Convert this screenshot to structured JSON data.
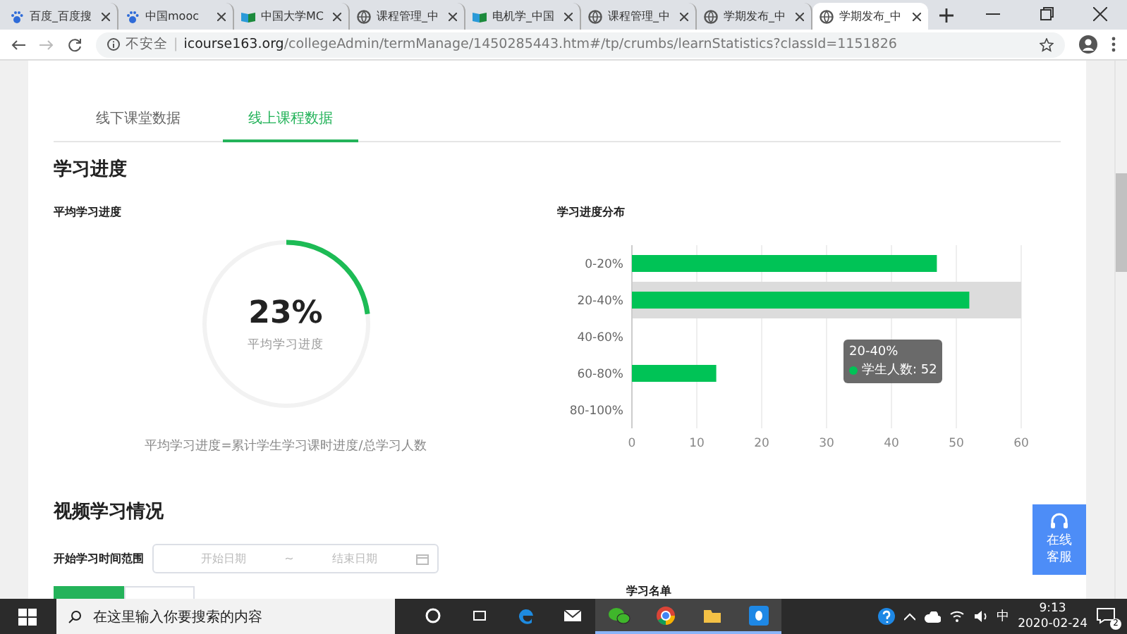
{
  "browser": {
    "tabs": [
      {
        "kind": "paw",
        "title": "百度_百度搜",
        "selected": false
      },
      {
        "kind": "paw",
        "title": "中国mooc",
        "selected": false
      },
      {
        "kind": "book",
        "title": "中国大学MC",
        "selected": false
      },
      {
        "kind": "globe",
        "title": "课程管理_中",
        "selected": false
      },
      {
        "kind": "book",
        "title": "电机学_中国",
        "selected": false
      },
      {
        "kind": "globe",
        "title": "课程管理_中",
        "selected": false
      },
      {
        "kind": "globe",
        "title": "学期发布_中",
        "selected": false
      },
      {
        "kind": "globe",
        "title": "学期发布_中",
        "selected": true
      }
    ],
    "security": "不安全",
    "security_divider": "|",
    "url": "**icourse163.org**/collegeAdmin/termManage/1450285443.htm#/tp/crumbs/learnStatistics?classId=1151826"
  },
  "page": {
    "tabs": [
      {
        "label": "线下课堂数据",
        "selected": false
      },
      {
        "label": "线上课程数据",
        "selected": true
      }
    ],
    "progress_section": {
      "title": "学习进度",
      "average": {
        "title": "平均学习进度",
        "value": "23%",
        "caption": "平均学习进度",
        "level": 0.23,
        "formula": "平均学习进度=累计学生学习课时进度/总学习人数"
      },
      "distribution": {
        "title": "学习进度分布",
        "tooltip": {
          "title": "20-40%",
          "text": "学生人数: 52",
          "color": "#00c356"
        },
        "chart_data": {
          "type": "bar",
          "orientation": "horizontal",
          "categories": [
            "0-20%",
            "20-40%",
            "40-60%",
            "60-80%",
            "80-100%"
          ],
          "series": [
            {
              "color": "#00c356",
              "values": [
                47,
                52,
                0,
                13,
                0
              ]
            }
          ],
          "xlim": [
            0,
            60
          ],
          "xticks": [
            0,
            10,
            20,
            30,
            40,
            50,
            60
          ],
          "grid": true,
          "bands": [
            {
              "axis": "y",
              "from": "20-40%",
              "to": "20-40%",
              "color": "#dcdcdc"
            }
          ]
        }
      }
    },
    "video_section": {
      "title": "视频学习情况",
      "range_label": "开始学习时间范围",
      "start_placeholder": "开始日期",
      "separator": "~",
      "end_placeholder": "结束日期",
      "toggle": [
        {
          "selected": true
        },
        {
          "selected": false
        }
      ],
      "list_title": "学习名单"
    },
    "service": {
      "label": "在线客服"
    }
  },
  "taskbar": {
    "search_placeholder": "在这里输入你要搜索的内容",
    "apps": [
      {
        "kind": "cortana",
        "active": false
      },
      {
        "kind": "taskview",
        "active": false
      },
      {
        "kind": "edge",
        "active": false
      },
      {
        "kind": "mail",
        "active": false
      },
      {
        "kind": "wechat",
        "active": true
      },
      {
        "kind": "chrome",
        "active": true
      },
      {
        "kind": "folder",
        "active": true
      },
      {
        "kind": "qq",
        "active": true
      }
    ],
    "ime": "中",
    "time": "9:13",
    "date": "2020-02-24",
    "notifications": "2"
  }
}
